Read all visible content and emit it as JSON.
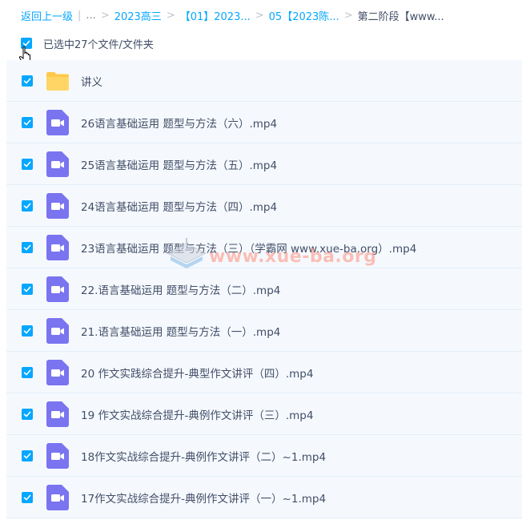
{
  "breadcrumb": {
    "back_label": "返回上一级",
    "items": [
      "...",
      "2023高三",
      "【01】2023...",
      "05【2023陈...",
      "第二阶段【www..."
    ],
    "separators": [
      "|",
      ">",
      ">",
      ">",
      ">"
    ]
  },
  "selection": {
    "text": "已选中27个文件/文件夹",
    "checked": true
  },
  "files": [
    {
      "name": "讲义",
      "type": "folder-icon",
      "checked": true
    },
    {
      "name": "26语言基础运用 题型与方法（六）.mp4",
      "type": "video-icon",
      "checked": true
    },
    {
      "name": "25语言基础运用 题型与方法（五）.mp4",
      "type": "video-icon",
      "checked": true
    },
    {
      "name": "24语言基础运用 题型与方法（四）.mp4",
      "type": "video-icon",
      "checked": true
    },
    {
      "name": "23语言基础运用 题型与方法（三）（学霸网 www.xue-ba.org）.mp4",
      "type": "video-icon",
      "checked": true
    },
    {
      "name": "22.语言基础运用 题型与方法（二）.mp4",
      "type": "video-icon",
      "checked": true
    },
    {
      "name": "21.语言基础运用 题型与方法（一）.mp4",
      "type": "video-icon",
      "checked": true
    },
    {
      "name": "20 作文实践综合提升-典型作文讲评（四）.mp4",
      "type": "video-icon",
      "checked": true
    },
    {
      "name": "19 作文实战综合提升-典例作文讲评（三）.mp4",
      "type": "video-icon",
      "checked": true
    },
    {
      "name": "18作文实战综合提升-典例作文讲评（二）~1.mp4",
      "type": "video-icon",
      "checked": true
    },
    {
      "name": "17作文实战综合提升-典例作文讲评（一）~1.mp4",
      "type": "video-icon",
      "checked": true
    }
  ],
  "watermark": {
    "text": "www.xue-ba.org"
  },
  "colors": {
    "accent": "#06a7ff",
    "video_icon": "#7a74f0",
    "folder": "#ffc94a",
    "row_bg": "#f5f9fe"
  }
}
